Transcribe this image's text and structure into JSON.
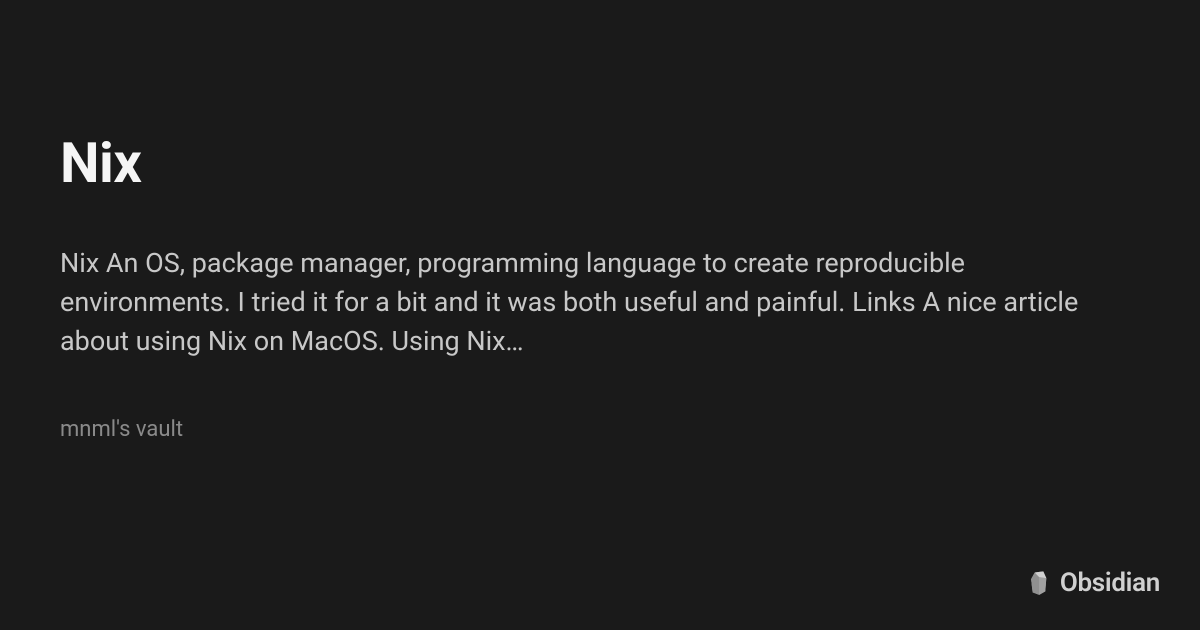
{
  "note": {
    "title": "Nix",
    "description": "Nix An OS, package manager, programming language to create reproducible environments. I tried it for a bit and it was both useful and painful. Links A nice article about using Nix on MacOS. Using Nix…",
    "vault": "mnml's vault"
  },
  "brand": {
    "name": "Obsidian"
  }
}
